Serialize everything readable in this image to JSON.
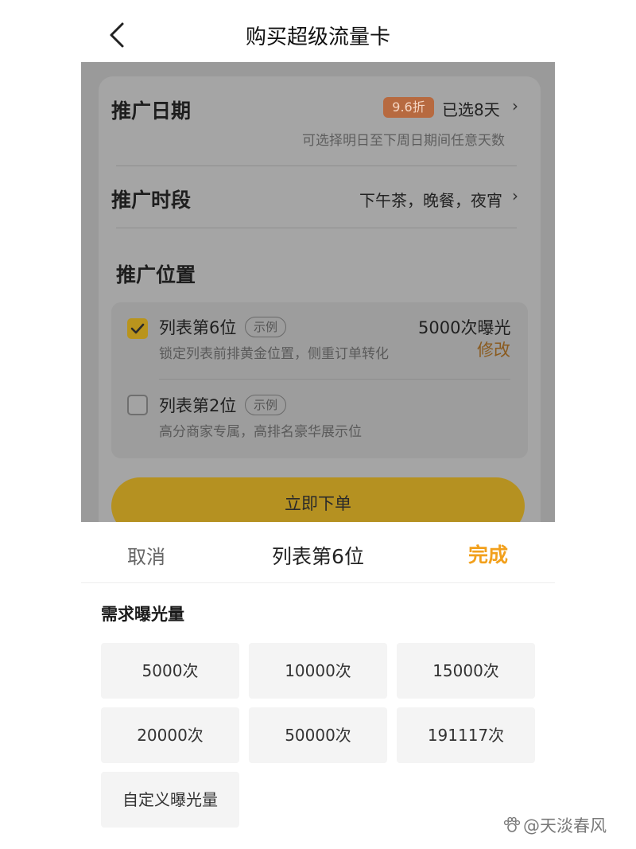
{
  "nav": {
    "title": "购买超级流量卡"
  },
  "promotion": {
    "date": {
      "label": "推广日期",
      "discount_badge": "9.6折",
      "selected": "已选8天",
      "hint": "可选择明日至下周日期间任意天数"
    },
    "time_slot": {
      "label": "推广时段",
      "value": "下午茶，晚餐，夜宵"
    },
    "position": {
      "label": "推广位置",
      "options": [
        {
          "title": "列表第6位",
          "tag": "示例",
          "desc": "锁定列表前排黄金位置，侧重订单转化",
          "amount": "5000次曝光",
          "edit_label": "修改",
          "checked": true
        },
        {
          "title": "列表第2位",
          "tag": "示例",
          "desc": "高分商家专属，高排名豪华展示位",
          "checked": false
        }
      ]
    },
    "order_button": "立即下单"
  },
  "sheet": {
    "cancel": "取消",
    "title": "列表第6位",
    "done": "完成",
    "section_label": "需求曝光量",
    "amounts": [
      "5000次",
      "10000次",
      "15000次",
      "20000次",
      "50000次",
      "191117次",
      "自定义曝光量"
    ]
  },
  "watermark": "@天淡春风",
  "colors": {
    "accent": "#f2a01c",
    "overlay": "#9a9a9a"
  },
  "icons": {
    "back": "chevron-left-icon",
    "check": "check-icon",
    "chevron": "chevron-right-icon"
  }
}
